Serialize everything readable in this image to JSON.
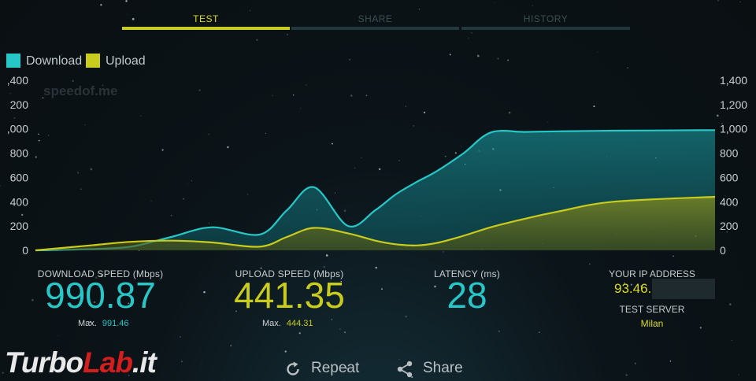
{
  "tabs": [
    {
      "label": "TEST",
      "active": true
    },
    {
      "label": "SHARE",
      "active": false
    },
    {
      "label": "HISTORY",
      "active": false
    }
  ],
  "legend": [
    {
      "label": "Download",
      "color": "#27c7c7"
    },
    {
      "label": "Upload",
      "color": "#c9cc1c"
    }
  ],
  "chart_watermark": "speedof.me",
  "chart_data": {
    "type": "area",
    "ylim": [
      0,
      1400
    ],
    "yticks_left": [
      ",400",
      "200",
      ",000",
      "800",
      "600",
      "400",
      "200",
      "0"
    ],
    "yticks_right": [
      "1,400",
      "1,200",
      "1,000",
      "800",
      "600",
      "400",
      "200",
      "0"
    ],
    "series": [
      {
        "name": "Download",
        "color": "#27c7c7",
        "x": [
          0,
          8,
          14,
          20,
          26,
          33,
          37,
          41,
          46,
          50,
          53,
          56,
          59,
          63,
          67,
          72,
          77,
          85,
          100
        ],
        "values": [
          0,
          10,
          30,
          110,
          190,
          130,
          330,
          520,
          200,
          330,
          460,
          560,
          650,
          800,
          970,
          975,
          980,
          985,
          990
        ]
      },
      {
        "name": "Upload",
        "color": "#c9cc1c",
        "x": [
          0,
          8,
          14,
          20,
          26,
          33,
          37,
          41,
          46,
          50,
          53,
          56,
          59,
          63,
          67,
          72,
          77,
          85,
          100
        ],
        "values": [
          0,
          40,
          70,
          80,
          65,
          30,
          110,
          185,
          140,
          80,
          50,
          40,
          60,
          120,
          190,
          260,
          320,
          400,
          441
        ]
      }
    ]
  },
  "metrics": {
    "download": {
      "label": "DOWNLOAD SPEED (Mbps)",
      "value": "990.87",
      "max_label": "Max.",
      "max_value": "991.46",
      "color": "#27c7c7"
    },
    "upload": {
      "label": "UPLOAD SPEED (Mbps)",
      "value": "441.35",
      "max_label": "Max.",
      "max_value": "444.31",
      "color": "#c9cc1c"
    },
    "latency": {
      "label": "LATENCY (ms)",
      "value": "28",
      "color": "#27c7c7"
    }
  },
  "ip": {
    "label": "YOUR IP ADDRESS",
    "value": "93.46.",
    "server_label": "TEST SERVER",
    "server_value": "Milan"
  },
  "actions": {
    "repeat": "Repeat",
    "share": "Share"
  },
  "brand": {
    "part1": "Turbo",
    "part2": "Lab",
    "part3": ".it"
  }
}
